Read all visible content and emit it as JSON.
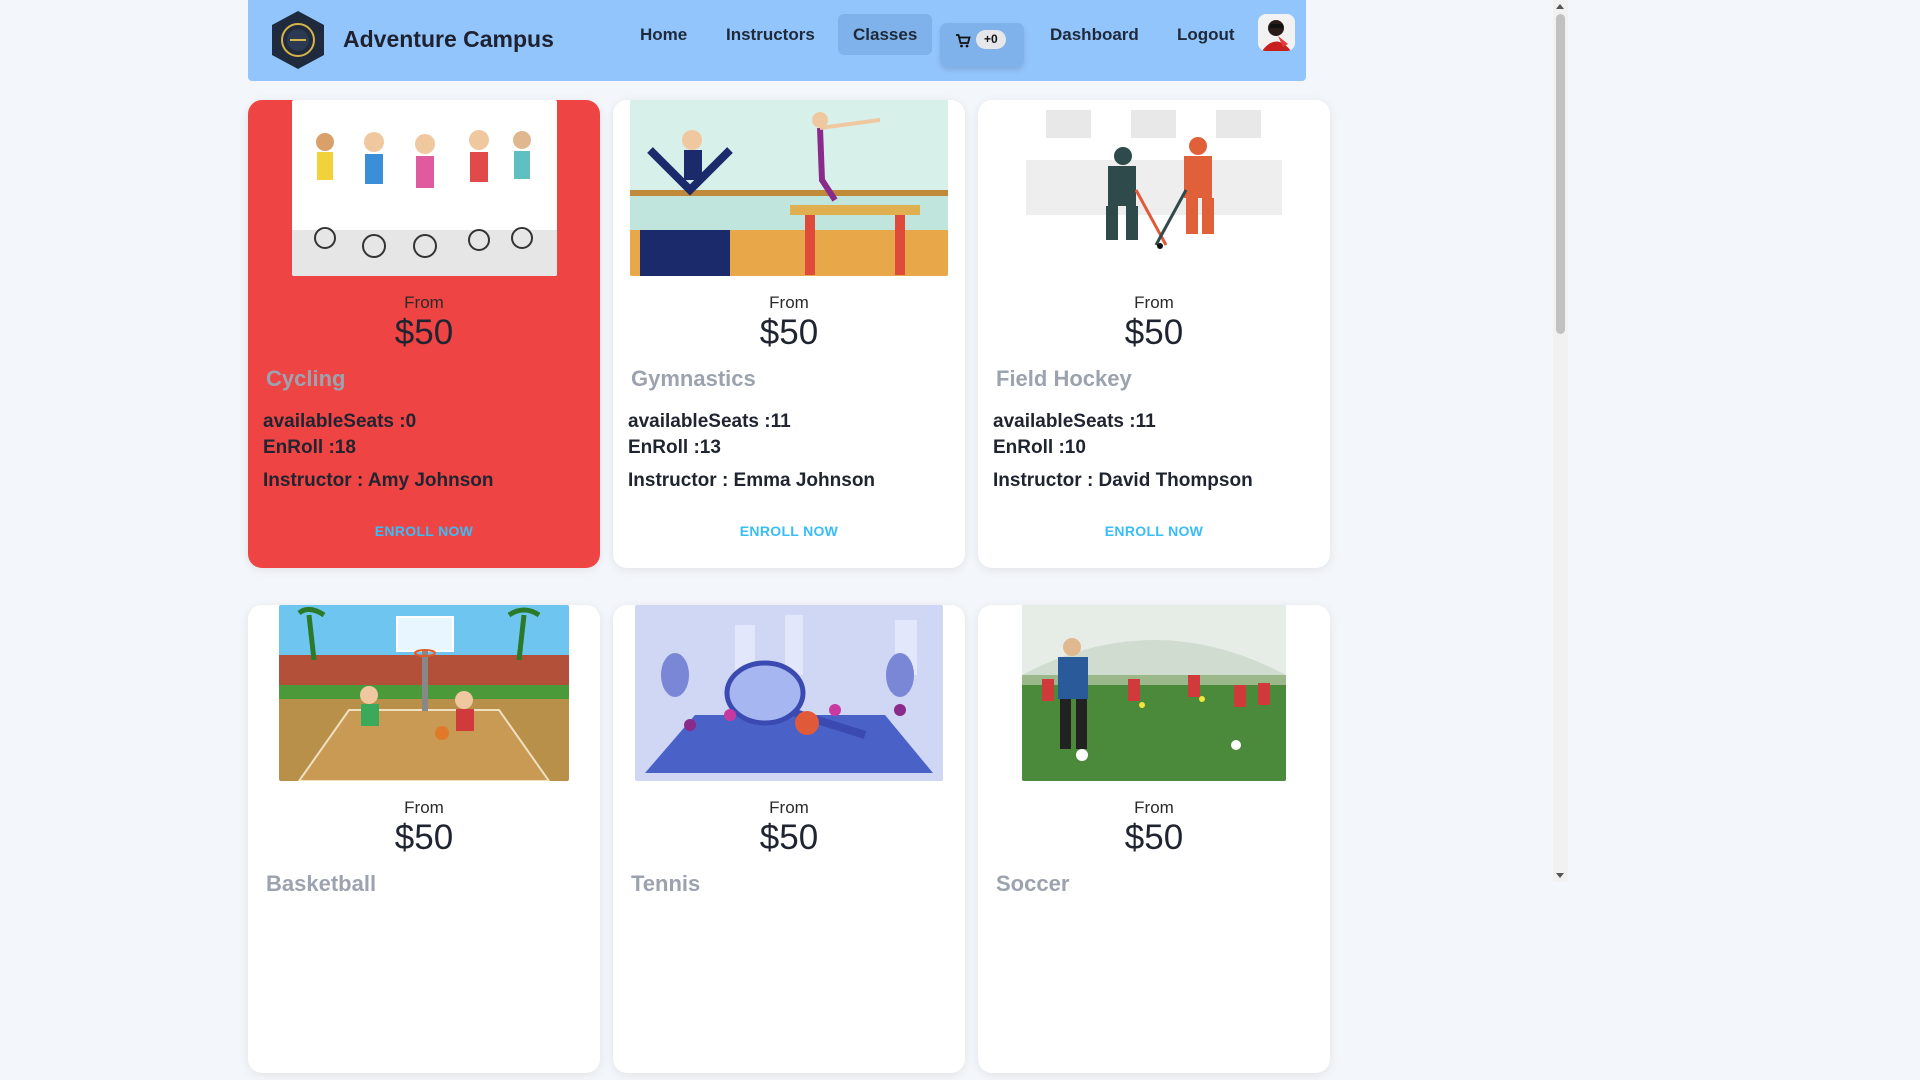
{
  "header": {
    "brand": "Adventure Campus",
    "nav": [
      "Home",
      "Instructors",
      "Classes",
      "Dashboard",
      "Logout"
    ],
    "active_nav": "Classes",
    "cart_count": "+0"
  },
  "classes": [
    {
      "from": "From",
      "price": "$50",
      "name": "Cycling",
      "seats": "availableSeats :0",
      "enroll": "EnRoll :18",
      "instructor": "Instructor : Amy Johnson",
      "button": "ENROLL NOW"
    },
    {
      "from": "From",
      "price": "$50",
      "name": "Gymnastics",
      "seats": "availableSeats :11",
      "enroll": "EnRoll :13",
      "instructor": "Instructor : Emma Johnson",
      "button": "ENROLL NOW"
    },
    {
      "from": "From",
      "price": "$50",
      "name": "Field Hockey",
      "seats": "availableSeats :11",
      "enroll": "EnRoll :10",
      "instructor": "Instructor : David Thompson",
      "button": "ENROLL NOW"
    },
    {
      "from": "From",
      "price": "$50",
      "name": "Basketball"
    },
    {
      "from": "From",
      "price": "$50",
      "name": "Tennis"
    },
    {
      "from": "From",
      "price": "$50",
      "name": "Soccer"
    }
  ],
  "colors": {
    "navbar": "#93c5fd",
    "highlight_card": "#ef4444",
    "enroll_button": "#38bdf8",
    "class_name": "#9ca3af"
  }
}
